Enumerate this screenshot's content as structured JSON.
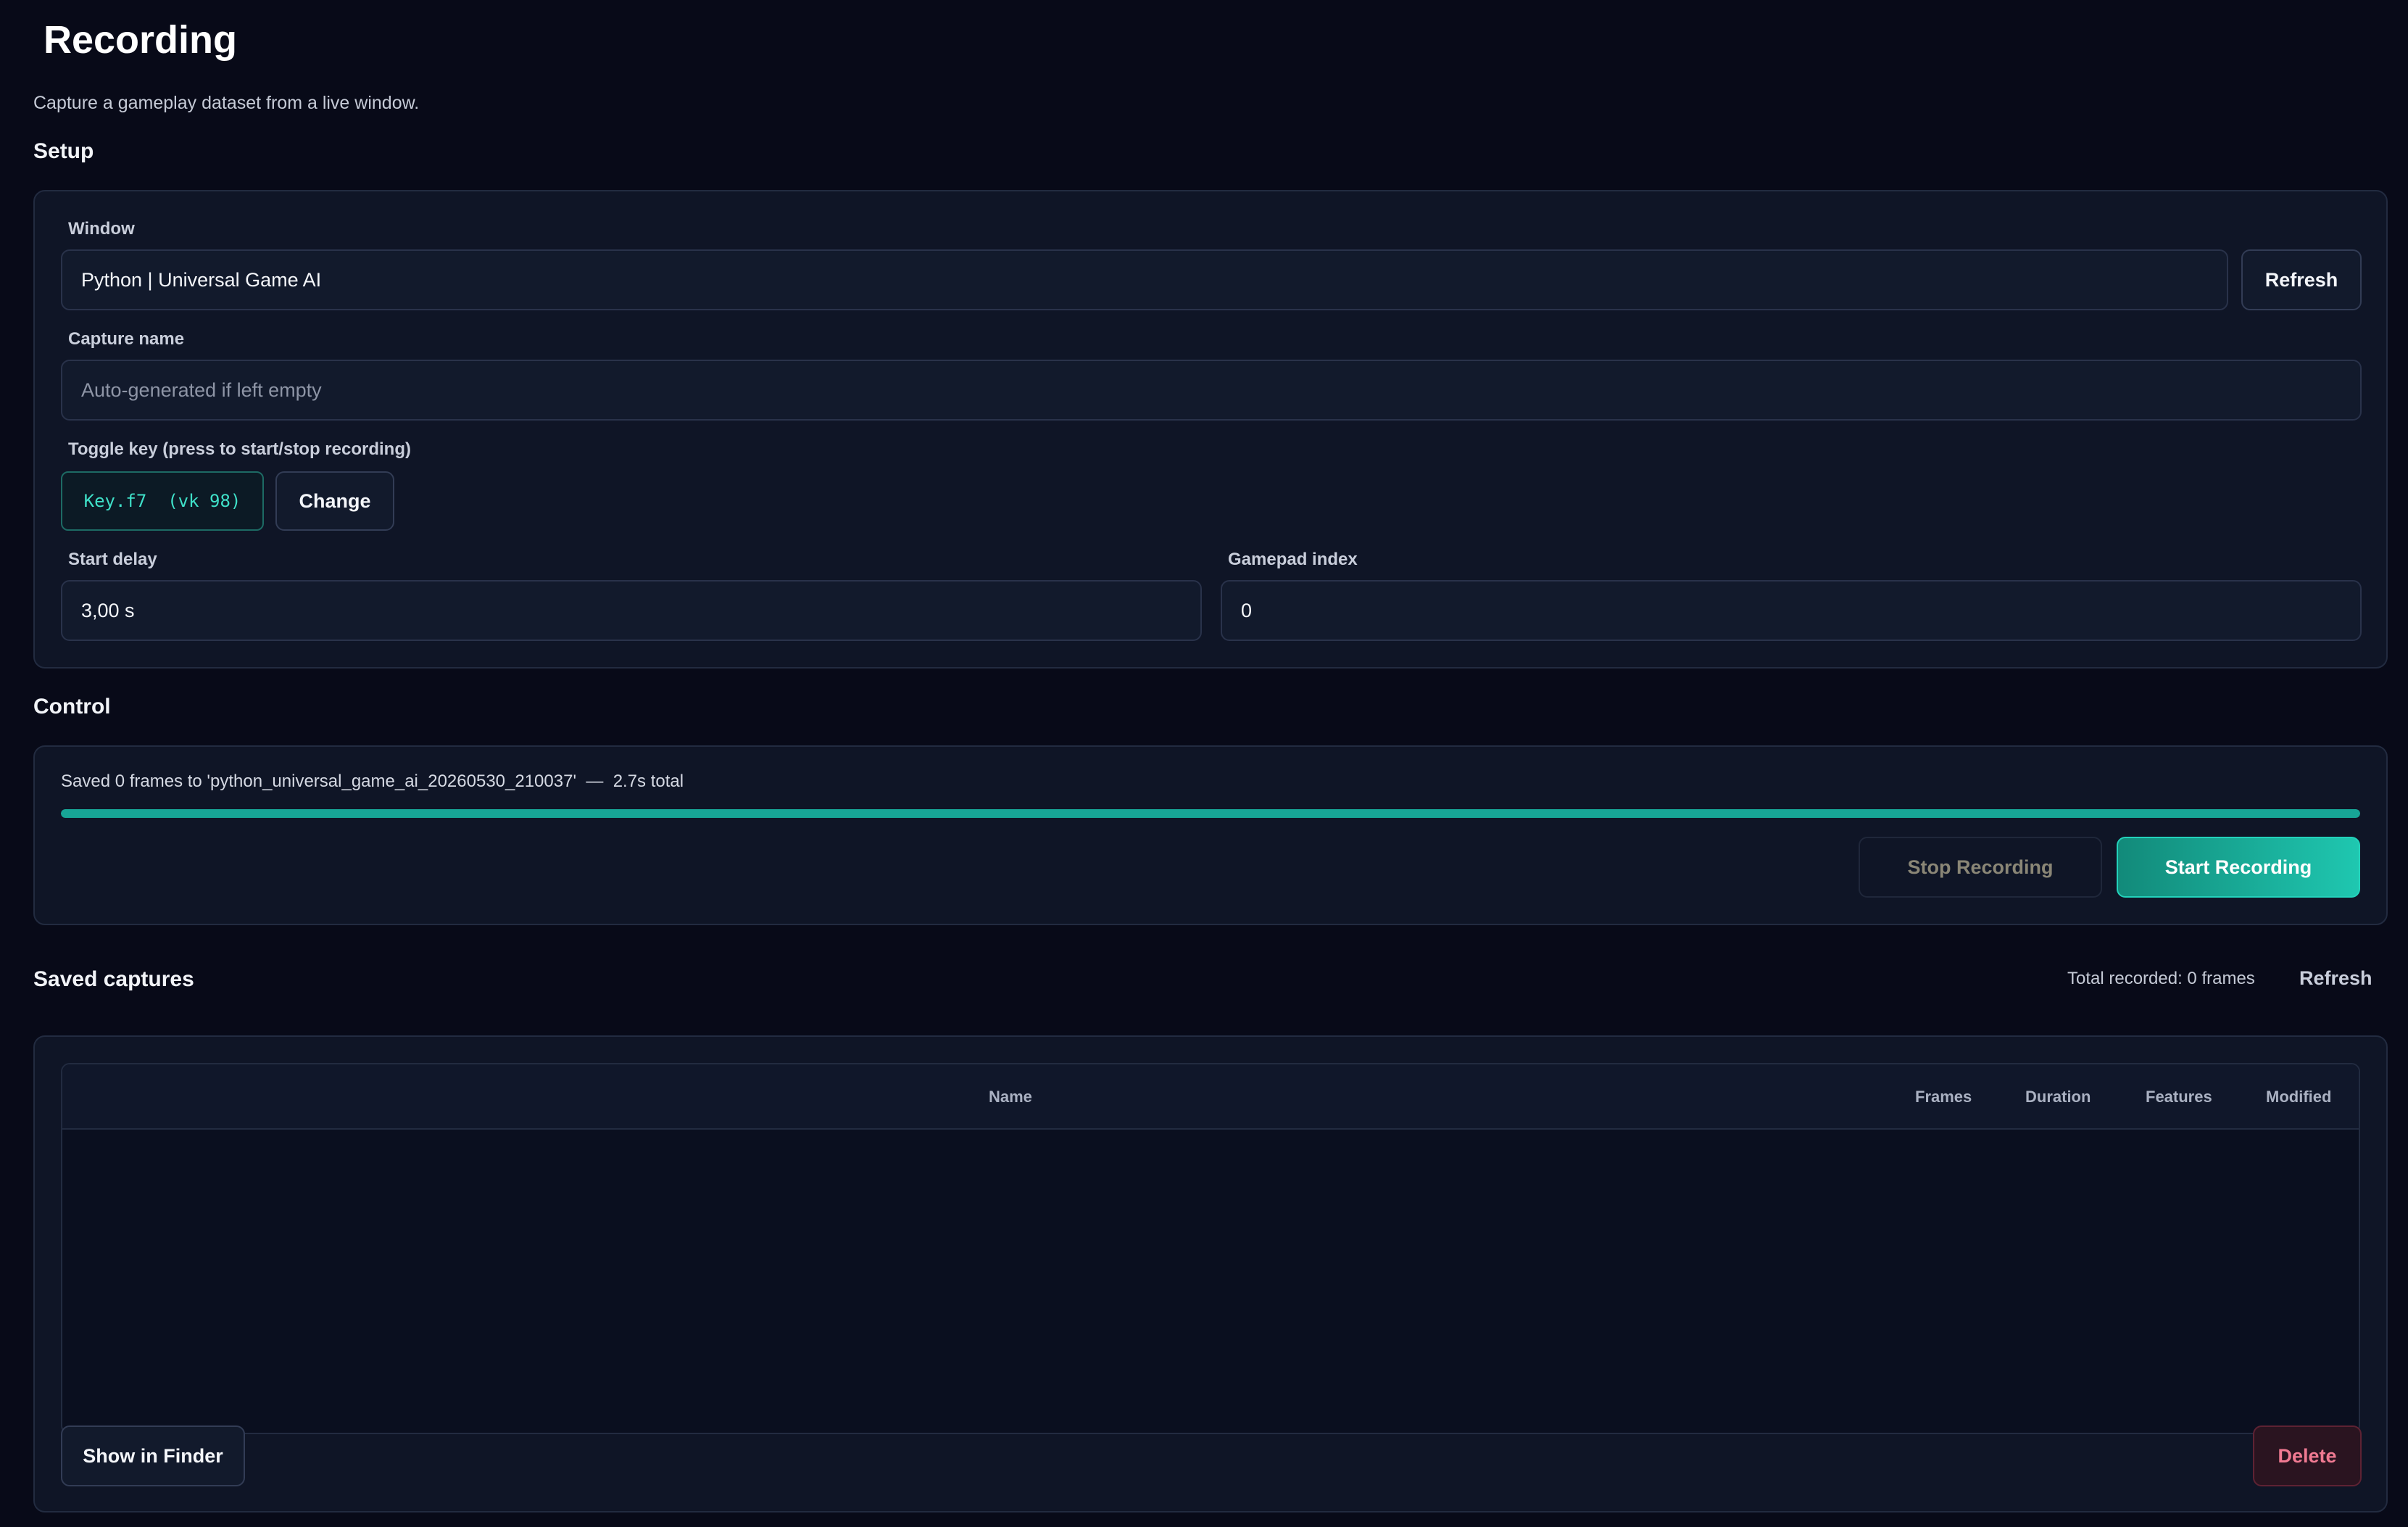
{
  "header": {
    "title": "Recording",
    "subtitle": "Capture a gameplay dataset from a live window."
  },
  "setup": {
    "heading": "Setup",
    "window_label": "Window",
    "window_value": "Python | Universal Game AI",
    "refresh_label": "Refresh",
    "capture_name_label": "Capture name",
    "capture_name_value": "",
    "capture_name_placeholder": "Auto-generated if left empty",
    "toggle_key_label": "Toggle key  (press to start/stop recording)",
    "toggle_key_value": "Key.f7  (vk 98)",
    "change_label": "Change",
    "start_delay_label": "Start delay",
    "start_delay_value": "3,00 s",
    "gamepad_label": "Gamepad index",
    "gamepad_value": "0"
  },
  "control": {
    "heading": "Control",
    "status": "Saved 0 frames to 'python_universal_game_ai_20260530_210037'  —  2.7s total",
    "progress": 1.0,
    "stop_label": "Stop Recording",
    "start_label": "Start Recording",
    "colors": {
      "accent": "#17a596",
      "accent_light": "#1fc7b0"
    }
  },
  "saved": {
    "heading": "Saved captures",
    "total": "Total recorded: 0 frames",
    "refresh_label": "Refresh",
    "columns": [
      "Name",
      "Frames",
      "Duration",
      "Features",
      "Modified"
    ],
    "rows": [],
    "show_in_finder_label": "Show in Finder",
    "delete_label": "Delete"
  }
}
